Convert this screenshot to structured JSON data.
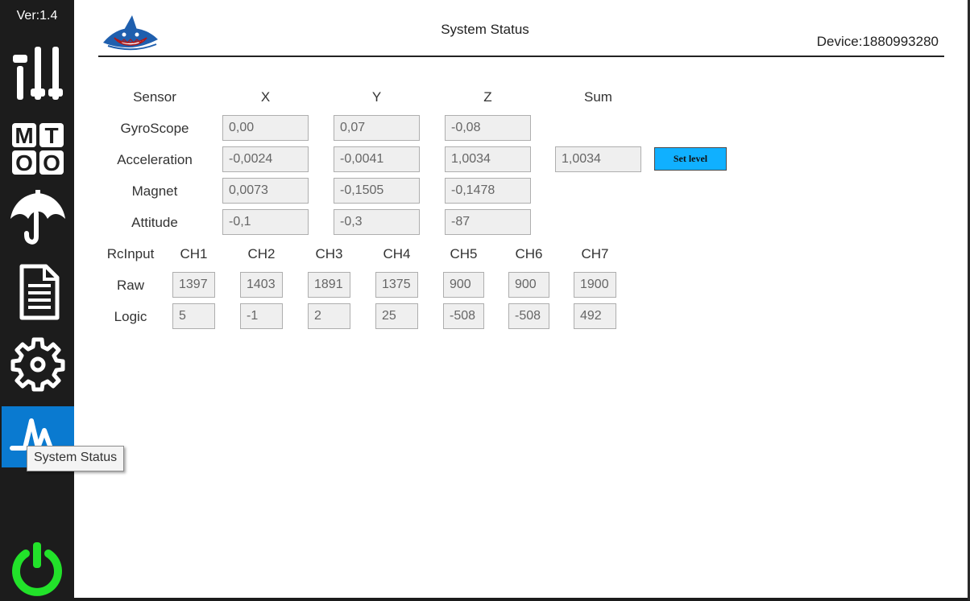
{
  "app": {
    "version": "Ver:1.4",
    "title": "System Status",
    "device": "Device:1880993280"
  },
  "sidebar": {
    "items": [
      {
        "name": "sliders",
        "icon": "sliders-icon"
      },
      {
        "name": "motor-test",
        "icon": "mt-oo-icon",
        "glyphs": [
          "M",
          "T",
          "O",
          "O"
        ]
      },
      {
        "name": "protection",
        "icon": "umbrella-icon"
      },
      {
        "name": "log",
        "icon": "document-icon"
      },
      {
        "name": "settings",
        "icon": "gear-icon"
      },
      {
        "name": "system-status",
        "icon": "pulse-icon",
        "active": true
      }
    ],
    "power_icon": "power-icon",
    "power_color": "#22e22a",
    "active_color": "#0a7ad0"
  },
  "tooltip": "System Status",
  "sensors": {
    "headers": {
      "sensor": "Sensor",
      "x": "X",
      "y": "Y",
      "z": "Z",
      "sum": "Sum"
    },
    "rows": [
      {
        "label": "GyroScope",
        "x": "0,00",
        "y": "0,07",
        "z": "-0,08"
      },
      {
        "label": "Acceleration",
        "x": "-0,0024",
        "y": "-0,0041",
        "z": "1,0034",
        "sum": "1,0034"
      },
      {
        "label": "Magnet",
        "x": "0,0073",
        "y": "-0,1505",
        "z": "-0,1478"
      },
      {
        "label": "Attitude",
        "x": "-0,1",
        "y": "-0,3",
        "z": "-87"
      }
    ],
    "set_level_label": "Set level",
    "set_level_color": "#10b0ff"
  },
  "rc": {
    "title": "RcInput",
    "channels": [
      "CH1",
      "CH2",
      "CH3",
      "CH4",
      "CH5",
      "CH6",
      "CH7"
    ],
    "raw_label": "Raw",
    "logic_label": "Logic",
    "raw": [
      "1397",
      "1403",
      "1891",
      "1375",
      "900",
      "900",
      "1900"
    ],
    "logic": [
      "5",
      "-1",
      "2",
      "25",
      "-508",
      "-508",
      "492"
    ]
  }
}
